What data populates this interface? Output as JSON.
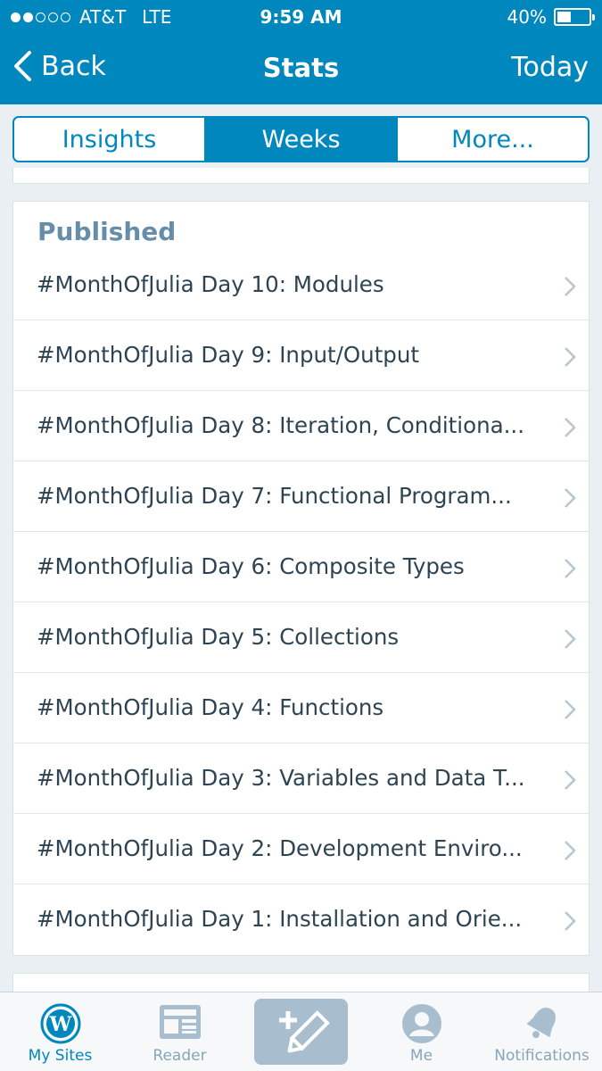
{
  "status_bar": {
    "carrier": "AT&T",
    "network": "LTE",
    "time": "9:59 AM",
    "battery": "40%",
    "battery_level": 0.4,
    "signal_bars": 2
  },
  "nav": {
    "back_label": "Back",
    "title": "Stats",
    "right_label": "Today"
  },
  "segments": [
    {
      "label": "Insights",
      "active": false
    },
    {
      "label": "Weeks",
      "active": true
    },
    {
      "label": "More...",
      "active": false
    }
  ],
  "published": {
    "heading": "Published",
    "posts": [
      "#MonthOfJulia Day 10: Modules",
      "#MonthOfJulia Day 9: Input/Output",
      "#MonthOfJulia Day 8: Iteration, Conditiona...",
      "#MonthOfJulia Day 7: Functional Program...",
      "#MonthOfJulia Day 6: Composite Types",
      "#MonthOfJulia Day 5: Collections",
      "#MonthOfJulia Day 4: Functions",
      "#MonthOfJulia Day 3: Variables and Data T...",
      "#MonthOfJulia Day 2: Development Enviro...",
      "#MonthOfJulia Day 1: Installation and Orie..."
    ]
  },
  "tab_bar": {
    "my_sites": "My Sites",
    "reader": "Reader",
    "me": "Me",
    "notifications": "Notifications"
  },
  "colors": {
    "brand_blue": "#0087be",
    "heading_blue": "#668eaa",
    "inactive_tab": "#87a6bc"
  }
}
